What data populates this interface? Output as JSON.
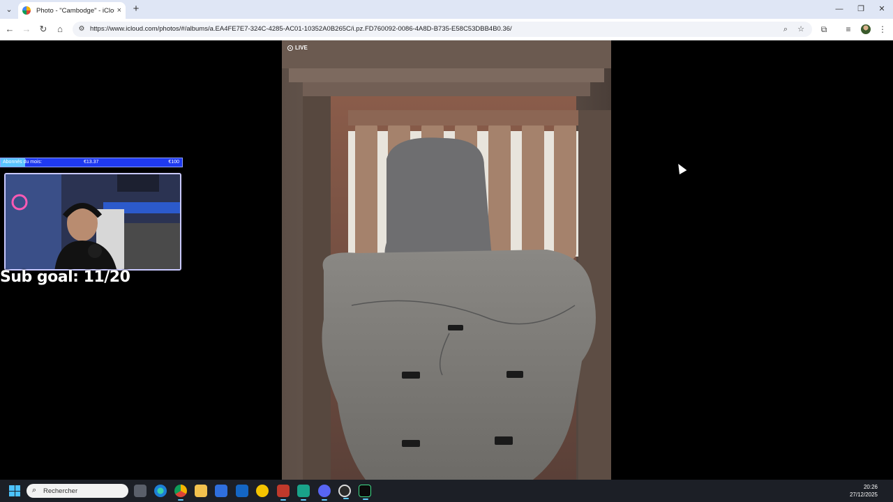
{
  "browser": {
    "tab_title": "Photo - \"Cambodge\" - iCloud P",
    "tab_close": "×",
    "new_tab": "+",
    "url": "https://www.icloud.com/photos/#/albums/a.EA4FE7E7-324C-4285-AC01-10352A0B265C/i.pz.FD760092-0086-4A8D-B735-E58C53DBB4B0.36/",
    "icons": [
      "tab-list-icon",
      "back-icon",
      "forward-icon",
      "reload-icon",
      "home-icon",
      "site-info-icon",
      "zoom-icon",
      "bookmark-star-icon",
      "extensions-icon",
      "media-control-icon",
      "profile-avatar",
      "menu-icon"
    ]
  },
  "window_controls": {
    "minimize": "—",
    "restore": "❐",
    "close": "✕"
  },
  "photo": {
    "live_label": "LIVE"
  },
  "stream_overlay": {
    "goal_label": "Abonnés du mois:",
    "goal_current": "€13.37",
    "goal_target": "€100",
    "goal_progress": 0.134,
    "sub_goal": "Sub goal: 11/20"
  },
  "taskbar": {
    "search_placeholder": "Rechercher",
    "time": "20:26",
    "date": "27/12/2025",
    "apps": [
      "task-view",
      "edge",
      "chrome",
      "file-explorer",
      "microsoft-store",
      "outlook",
      "norton",
      "voicemeeter",
      "app-green",
      "discord",
      "obs",
      "app-wave"
    ]
  },
  "colors": {
    "tab_strip": "#dfe6f5",
    "goal_bar": "#1f3af0",
    "goal_fill": "#59c3ff",
    "taskbar": "#1c1f26"
  }
}
